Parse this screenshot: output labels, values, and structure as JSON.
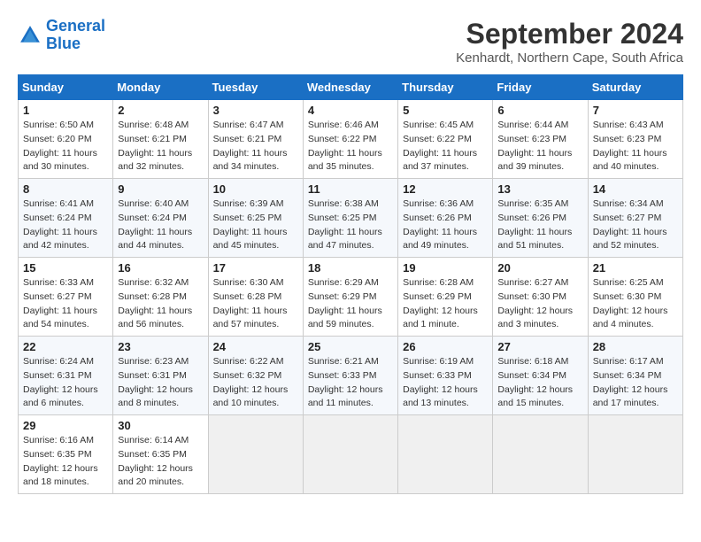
{
  "logo": {
    "line1": "General",
    "line2": "Blue"
  },
  "title": "September 2024",
  "subtitle": "Kenhardt, Northern Cape, South Africa",
  "days_of_week": [
    "Sunday",
    "Monday",
    "Tuesday",
    "Wednesday",
    "Thursday",
    "Friday",
    "Saturday"
  ],
  "weeks": [
    [
      {
        "day": "1",
        "sunrise": "Sunrise: 6:50 AM",
        "sunset": "Sunset: 6:20 PM",
        "daylight": "Daylight: 11 hours and 30 minutes."
      },
      {
        "day": "2",
        "sunrise": "Sunrise: 6:48 AM",
        "sunset": "Sunset: 6:21 PM",
        "daylight": "Daylight: 11 hours and 32 minutes."
      },
      {
        "day": "3",
        "sunrise": "Sunrise: 6:47 AM",
        "sunset": "Sunset: 6:21 PM",
        "daylight": "Daylight: 11 hours and 34 minutes."
      },
      {
        "day": "4",
        "sunrise": "Sunrise: 6:46 AM",
        "sunset": "Sunset: 6:22 PM",
        "daylight": "Daylight: 11 hours and 35 minutes."
      },
      {
        "day": "5",
        "sunrise": "Sunrise: 6:45 AM",
        "sunset": "Sunset: 6:22 PM",
        "daylight": "Daylight: 11 hours and 37 minutes."
      },
      {
        "day": "6",
        "sunrise": "Sunrise: 6:44 AM",
        "sunset": "Sunset: 6:23 PM",
        "daylight": "Daylight: 11 hours and 39 minutes."
      },
      {
        "day": "7",
        "sunrise": "Sunrise: 6:43 AM",
        "sunset": "Sunset: 6:23 PM",
        "daylight": "Daylight: 11 hours and 40 minutes."
      }
    ],
    [
      {
        "day": "8",
        "sunrise": "Sunrise: 6:41 AM",
        "sunset": "Sunset: 6:24 PM",
        "daylight": "Daylight: 11 hours and 42 minutes."
      },
      {
        "day": "9",
        "sunrise": "Sunrise: 6:40 AM",
        "sunset": "Sunset: 6:24 PM",
        "daylight": "Daylight: 11 hours and 44 minutes."
      },
      {
        "day": "10",
        "sunrise": "Sunrise: 6:39 AM",
        "sunset": "Sunset: 6:25 PM",
        "daylight": "Daylight: 11 hours and 45 minutes."
      },
      {
        "day": "11",
        "sunrise": "Sunrise: 6:38 AM",
        "sunset": "Sunset: 6:25 PM",
        "daylight": "Daylight: 11 hours and 47 minutes."
      },
      {
        "day": "12",
        "sunrise": "Sunrise: 6:36 AM",
        "sunset": "Sunset: 6:26 PM",
        "daylight": "Daylight: 11 hours and 49 minutes."
      },
      {
        "day": "13",
        "sunrise": "Sunrise: 6:35 AM",
        "sunset": "Sunset: 6:26 PM",
        "daylight": "Daylight: 11 hours and 51 minutes."
      },
      {
        "day": "14",
        "sunrise": "Sunrise: 6:34 AM",
        "sunset": "Sunset: 6:27 PM",
        "daylight": "Daylight: 11 hours and 52 minutes."
      }
    ],
    [
      {
        "day": "15",
        "sunrise": "Sunrise: 6:33 AM",
        "sunset": "Sunset: 6:27 PM",
        "daylight": "Daylight: 11 hours and 54 minutes."
      },
      {
        "day": "16",
        "sunrise": "Sunrise: 6:32 AM",
        "sunset": "Sunset: 6:28 PM",
        "daylight": "Daylight: 11 hours and 56 minutes."
      },
      {
        "day": "17",
        "sunrise": "Sunrise: 6:30 AM",
        "sunset": "Sunset: 6:28 PM",
        "daylight": "Daylight: 11 hours and 57 minutes."
      },
      {
        "day": "18",
        "sunrise": "Sunrise: 6:29 AM",
        "sunset": "Sunset: 6:29 PM",
        "daylight": "Daylight: 11 hours and 59 minutes."
      },
      {
        "day": "19",
        "sunrise": "Sunrise: 6:28 AM",
        "sunset": "Sunset: 6:29 PM",
        "daylight": "Daylight: 12 hours and 1 minute."
      },
      {
        "day": "20",
        "sunrise": "Sunrise: 6:27 AM",
        "sunset": "Sunset: 6:30 PM",
        "daylight": "Daylight: 12 hours and 3 minutes."
      },
      {
        "day": "21",
        "sunrise": "Sunrise: 6:25 AM",
        "sunset": "Sunset: 6:30 PM",
        "daylight": "Daylight: 12 hours and 4 minutes."
      }
    ],
    [
      {
        "day": "22",
        "sunrise": "Sunrise: 6:24 AM",
        "sunset": "Sunset: 6:31 PM",
        "daylight": "Daylight: 12 hours and 6 minutes."
      },
      {
        "day": "23",
        "sunrise": "Sunrise: 6:23 AM",
        "sunset": "Sunset: 6:31 PM",
        "daylight": "Daylight: 12 hours and 8 minutes."
      },
      {
        "day": "24",
        "sunrise": "Sunrise: 6:22 AM",
        "sunset": "Sunset: 6:32 PM",
        "daylight": "Daylight: 12 hours and 10 minutes."
      },
      {
        "day": "25",
        "sunrise": "Sunrise: 6:21 AM",
        "sunset": "Sunset: 6:33 PM",
        "daylight": "Daylight: 12 hours and 11 minutes."
      },
      {
        "day": "26",
        "sunrise": "Sunrise: 6:19 AM",
        "sunset": "Sunset: 6:33 PM",
        "daylight": "Daylight: 12 hours and 13 minutes."
      },
      {
        "day": "27",
        "sunrise": "Sunrise: 6:18 AM",
        "sunset": "Sunset: 6:34 PM",
        "daylight": "Daylight: 12 hours and 15 minutes."
      },
      {
        "day": "28",
        "sunrise": "Sunrise: 6:17 AM",
        "sunset": "Sunset: 6:34 PM",
        "daylight": "Daylight: 12 hours and 17 minutes."
      }
    ],
    [
      {
        "day": "29",
        "sunrise": "Sunrise: 6:16 AM",
        "sunset": "Sunset: 6:35 PM",
        "daylight": "Daylight: 12 hours and 18 minutes."
      },
      {
        "day": "30",
        "sunrise": "Sunrise: 6:14 AM",
        "sunset": "Sunset: 6:35 PM",
        "daylight": "Daylight: 12 hours and 20 minutes."
      },
      null,
      null,
      null,
      null,
      null
    ]
  ]
}
